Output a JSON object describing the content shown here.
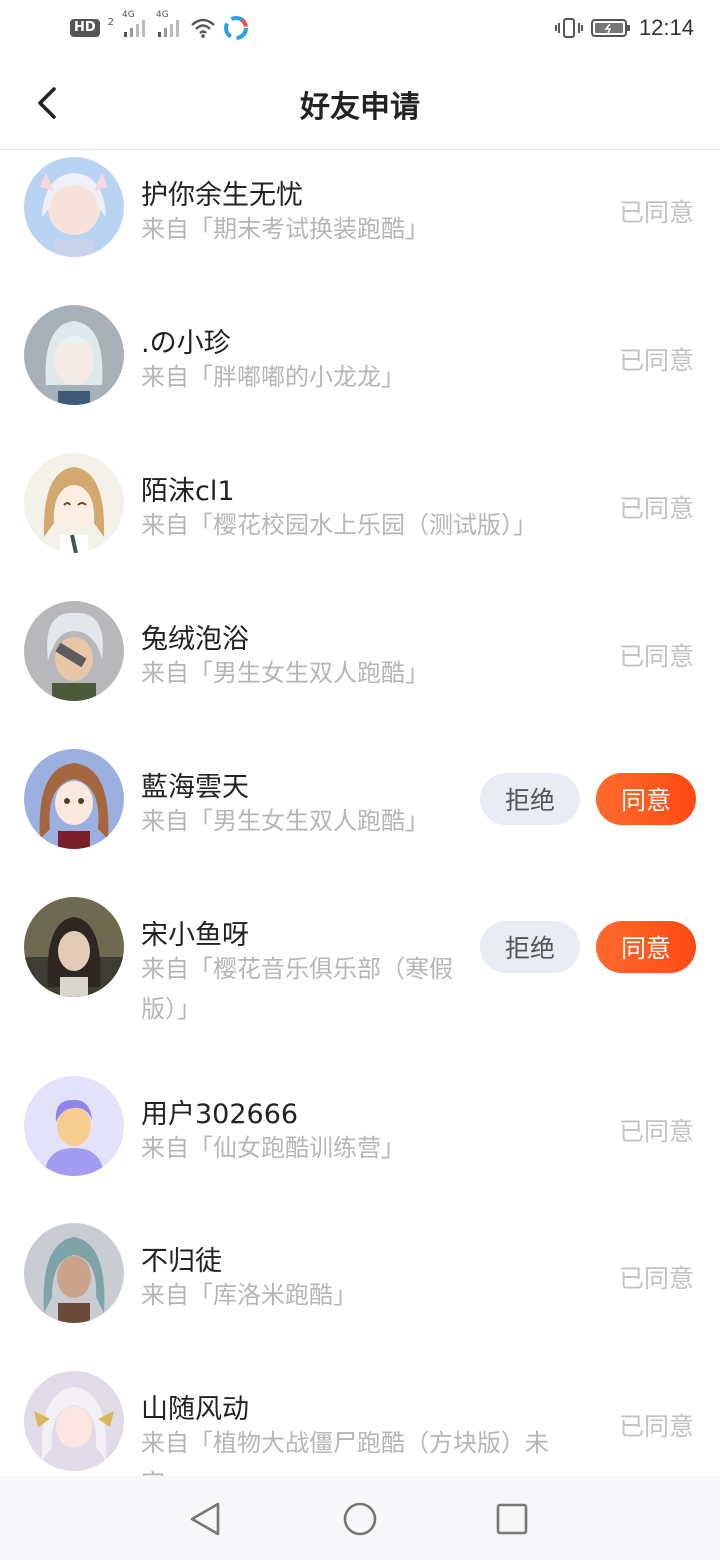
{
  "status_bar": {
    "hd_label": "HD",
    "sim_label": "2",
    "net1": "4G",
    "net2": "4G",
    "time": "12:14",
    "icons": [
      "signal-icon",
      "wifi-icon",
      "app-icon",
      "vibrate-icon",
      "battery-icon"
    ]
  },
  "header": {
    "title": "好友申请",
    "back_icon": "chevron-left-icon"
  },
  "requests": [
    {
      "name": "护你余生无忧",
      "source": "来自「期末考试换装跑酷」",
      "status": "已同意",
      "pending": false,
      "avatar": "anime-girl-white-hair"
    },
    {
      "name": ".の小珍",
      "source": "来自「胖嘟嘟的小龙龙」",
      "status": "已同意",
      "pending": false,
      "avatar": "anime-character-white-hair"
    },
    {
      "name": "陌沫cl1",
      "source": "来自「樱花校园水上乐园（测试版）」",
      "status": "已同意",
      "pending": false,
      "avatar": "anime-girl-blonde"
    },
    {
      "name": "兔绒泡浴",
      "source": "来自「男生女生双人跑酷」",
      "status": "已同意",
      "pending": false,
      "avatar": "anime-boy-silver-hair"
    },
    {
      "name": "藍海雲天",
      "source": "来自「男生女生双人跑酷」",
      "status": "",
      "pending": true,
      "reject_label": "拒绝",
      "accept_label": "同意",
      "avatar": "anime-girl-brown-hair"
    },
    {
      "name": "宋小鱼呀",
      "source": "来自「樱花音乐俱乐部（寒假版）」",
      "status": "",
      "pending": true,
      "reject_label": "拒绝",
      "accept_label": "同意",
      "avatar": "photo-person"
    },
    {
      "name": "用户302666",
      "source": "来自「仙女跑酷训练营」",
      "status": "已同意",
      "pending": false,
      "avatar": "default-user-avatar"
    },
    {
      "name": "不归徒",
      "source": "来自「库洛米跑酷」",
      "status": "已同意",
      "pending": false,
      "avatar": "3d-character-teal-hair"
    },
    {
      "name": "山随风动",
      "source": "来自「植物大战僵尸跑酷（方块版）未完」",
      "status": "已同意",
      "pending": false,
      "avatar": "anime-character-white-hair-horns"
    }
  ],
  "navbar": {
    "back": "triangle-back-icon",
    "home": "circle-home-icon",
    "recent": "square-recent-icon"
  },
  "colors": {
    "accent": "#ff5a1e",
    "reject_bg": "#e9edf3",
    "muted_text": "#b6b6b6"
  }
}
